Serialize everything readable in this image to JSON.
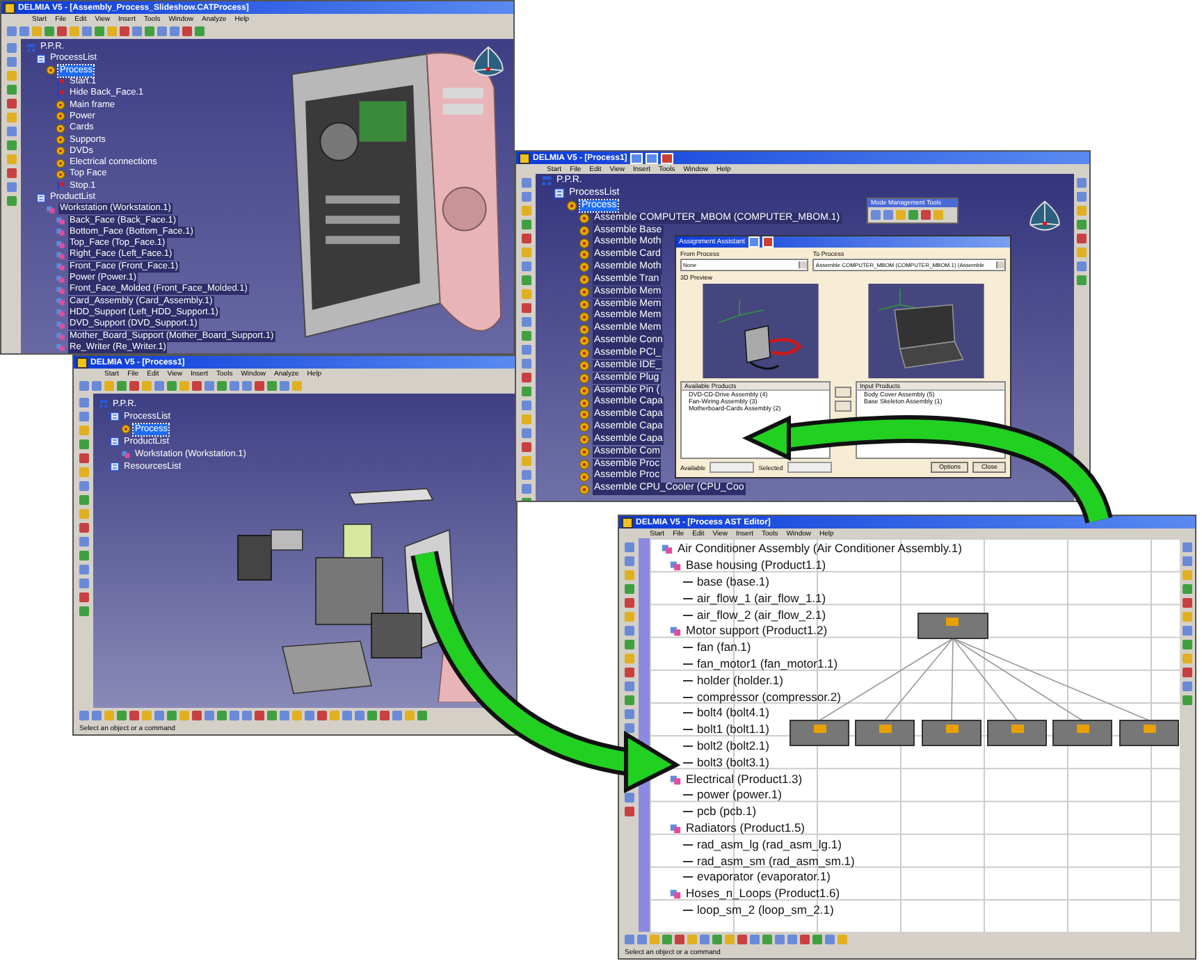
{
  "windows": [
    {
      "title": "DELMIA V5 - [Assembly_Process_Slideshow.CATProcess]",
      "menu": [
        "Start",
        "File",
        "Edit",
        "View",
        "Insert",
        "Tools",
        "Window",
        "Analyze",
        "Help"
      ],
      "tree": [
        {
          "label": "P.P.R.",
          "kind": "root",
          "selected": false,
          "highlighted": false,
          "children": [
            {
              "label": "ProcessList",
              "kind": "list",
              "selected": false,
              "highlighted": false,
              "children": [
                {
                  "label": "Process",
                  "kind": "process",
                  "selected": true,
                  "highlighted": false,
                  "children": [
                    {
                      "label": "Start.1",
                      "kind": "step",
                      "selected": false,
                      "highlighted": false
                    },
                    {
                      "label": "Hide Back_Face.1",
                      "kind": "step",
                      "selected": false,
                      "highlighted": false
                    },
                    {
                      "label": "Main frame",
                      "kind": "process",
                      "selected": false,
                      "highlighted": false
                    },
                    {
                      "label": "Power",
                      "kind": "process",
                      "selected": false,
                      "highlighted": false
                    },
                    {
                      "label": "Cards",
                      "kind": "process",
                      "selected": false,
                      "highlighted": false
                    },
                    {
                      "label": "Supports",
                      "kind": "process",
                      "selected": false,
                      "highlighted": false
                    },
                    {
                      "label": "DVDs",
                      "kind": "process",
                      "selected": false,
                      "highlighted": false
                    },
                    {
                      "label": "Electrical connections",
                      "kind": "process",
                      "selected": false,
                      "highlighted": false
                    },
                    {
                      "label": "Top Face",
                      "kind": "process",
                      "selected": false,
                      "highlighted": false
                    },
                    {
                      "label": "Stop.1",
                      "kind": "step",
                      "selected": false,
                      "highlighted": false
                    }
                  ]
                }
              ]
            },
            {
              "label": "ProductList",
              "kind": "list",
              "selected": false,
              "highlighted": false,
              "children": [
                {
                  "label": "Workstation (Workstation.1)",
                  "kind": "product",
                  "selected": false,
                  "highlighted": true,
                  "children": [
                    {
                      "label": "Back_Face (Back_Face.1)",
                      "kind": "product",
                      "selected": false,
                      "highlighted": true
                    },
                    {
                      "label": "Bottom_Face (Bottom_Face.1)",
                      "kind": "product",
                      "selected": false,
                      "highlighted": true
                    },
                    {
                      "label": "Top_Face (Top_Face.1)",
                      "kind": "product",
                      "selected": false,
                      "highlighted": true
                    },
                    {
                      "label": "Right_Face (Left_Face.1)",
                      "kind": "product",
                      "selected": false,
                      "highlighted": true
                    },
                    {
                      "label": "Front_Face (Front_Face.1)",
                      "kind": "product",
                      "selected": false,
                      "highlighted": true
                    },
                    {
                      "label": "Power (Power.1)",
                      "kind": "product",
                      "selected": false,
                      "highlighted": true
                    },
                    {
                      "label": "Front_Face_Molded (Front_Face_Molded.1)",
                      "kind": "product",
                      "selected": false,
                      "highlighted": true
                    },
                    {
                      "label": "Card_Assembly (Card_Assembly.1)",
                      "kind": "product",
                      "selected": false,
                      "highlighted": true
                    },
                    {
                      "label": "HDD_Support (Left_HDD_Support.1)",
                      "kind": "product",
                      "selected": false,
                      "highlighted": true
                    },
                    {
                      "label": "DVD_Support (DVD_Support.1)",
                      "kind": "product",
                      "selected": false,
                      "highlighted": true
                    },
                    {
                      "label": "Mother_Board_Support (Mother_Board_Support.1)",
                      "kind": "product",
                      "selected": false,
                      "highlighted": true
                    },
                    {
                      "label": "Re_Writer (Re_Writer.1)",
                      "kind": "product",
                      "selected": false,
                      "highlighted": true
                    }
                  ]
                }
              ]
            }
          ]
        }
      ]
    },
    {
      "title": "DELMIA V5 - [Process1]",
      "menu": [
        "Start",
        "File",
        "Edit",
        "View",
        "Insert",
        "Tools",
        "Window",
        "Analyze",
        "Help"
      ],
      "tree": [
        {
          "label": "P.P.R.",
          "kind": "root",
          "selected": false,
          "highlighted": false,
          "children": [
            {
              "label": "ProcessList",
              "kind": "list",
              "selected": false,
              "highlighted": false,
              "children": [
                {
                  "label": "Process",
                  "kind": "process",
                  "selected": true,
                  "highlighted": false
                }
              ]
            },
            {
              "label": "ProductList",
              "kind": "list",
              "selected": false,
              "highlighted": false,
              "children": [
                {
                  "label": "Workstation (Workstation.1)",
                  "kind": "product",
                  "selected": false,
                  "highlighted": false
                }
              ]
            },
            {
              "label": "ResourcesList",
              "kind": "list",
              "selected": false,
              "highlighted": false
            }
          ]
        }
      ],
      "status": "Select an object or a command"
    },
    {
      "title": "DELMIA V5 - [Process1]",
      "menu": [
        "Start",
        "File",
        "Edit",
        "View",
        "Insert",
        "Tools",
        "Window",
        "Help"
      ],
      "tree": [
        {
          "label": "P.P.R.",
          "kind": "root",
          "selected": false,
          "highlighted": false,
          "children": [
            {
              "label": "ProcessList",
              "kind": "list",
              "selected": false,
              "highlighted": false,
              "children": [
                {
                  "label": "Process",
                  "kind": "process",
                  "selected": true,
                  "highlighted": false,
                  "children": [
                    {
                      "label": "Assemble COMPUTER_MBOM (COMPUTER_MBOM.1)",
                      "kind": "process",
                      "selected": false,
                      "highlighted": true
                    },
                    {
                      "label": "Assemble Base",
                      "kind": "process",
                      "selected": false,
                      "highlighted": true
                    },
                    {
                      "label": "Assemble Moth",
                      "kind": "process",
                      "selected": false,
                      "highlighted": true
                    },
                    {
                      "label": "Assemble Card",
                      "kind": "process",
                      "selected": false,
                      "highlighted": true
                    },
                    {
                      "label": "Assemble Moth",
                      "kind": "process",
                      "selected": false,
                      "highlighted": true
                    },
                    {
                      "label": "Assemble Tran",
                      "kind": "process",
                      "selected": false,
                      "highlighted": true
                    },
                    {
                      "label": "Assemble Mem",
                      "kind": "process",
                      "selected": false,
                      "highlighted": true
                    },
                    {
                      "label": "Assemble Mem",
                      "kind": "process",
                      "selected": false,
                      "highlighted": true
                    },
                    {
                      "label": "Assemble Mem",
                      "kind": "process",
                      "selected": false,
                      "highlighted": true
                    },
                    {
                      "label": "Assemble Mem",
                      "kind": "process",
                      "selected": false,
                      "highlighted": true
                    },
                    {
                      "label": "Assemble Conn",
                      "kind": "process",
                      "selected": false,
                      "highlighted": true
                    },
                    {
                      "label": "Assemble PCI_",
                      "kind": "process",
                      "selected": false,
                      "highlighted": true
                    },
                    {
                      "label": "Assemble IDE_",
                      "kind": "process",
                      "selected": false,
                      "highlighted": true
                    },
                    {
                      "label": "Assemble Plug",
                      "kind": "process",
                      "selected": false,
                      "highlighted": true
                    },
                    {
                      "label": "Assemble Pin (",
                      "kind": "process",
                      "selected": false,
                      "highlighted": true
                    },
                    {
                      "label": "Assemble Capa",
                      "kind": "process",
                      "selected": false,
                      "highlighted": true
                    },
                    {
                      "label": "Assemble Capa",
                      "kind": "process",
                      "selected": false,
                      "highlighted": true
                    },
                    {
                      "label": "Assemble Capa",
                      "kind": "process",
                      "selected": false,
                      "highlighted": true
                    },
                    {
                      "label": "Assemble Capa",
                      "kind": "process",
                      "selected": false,
                      "highlighted": true
                    },
                    {
                      "label": "Assemble Com",
                      "kind": "process",
                      "selected": false,
                      "highlighted": true
                    },
                    {
                      "label": "Assemble Proc",
                      "kind": "process",
                      "selected": false,
                      "highlighted": true
                    },
                    {
                      "label": "Assemble Proc",
                      "kind": "process",
                      "selected": false,
                      "highlighted": true
                    },
                    {
                      "label": "Assemble CPU_Cooler (CPU_Coo",
                      "kind": "process",
                      "selected": false,
                      "highlighted": true
                    }
                  ]
                }
              ]
            }
          ]
        }
      ],
      "floating_toolbar": {
        "title": "Mode Management Tools"
      },
      "dialog": {
        "title": "Assignment Assistant",
        "from_label": "From Process",
        "from_value": "None",
        "to_label": "To Process",
        "to_value": "Assemble COMPUTER_MBOM (COMPUTER_MBOM.1) (Assemble",
        "preview_label": "3D Preview",
        "available_header": "Available Products",
        "available_items": [
          "DVD-CD-Drive Assembly (4)",
          "Fan-Wiring Assembly (3)",
          "Motherboard-Cards Assembly (2)"
        ],
        "input_header": "Input Products",
        "input_items": [
          "Body Cover Assembly (5)",
          "Base Skeleton Assembly (1)"
        ],
        "available_label": "Available",
        "selected_label": "Selected",
        "buttons": [
          "Options",
          "Close"
        ]
      }
    },
    {
      "title": "DELMIA V5 - [Process AST Editor]",
      "menu": [
        "Start",
        "File",
        "Edit",
        "View",
        "Insert",
        "Tools",
        "Window",
        "Help"
      ],
      "tree": [
        {
          "label": "Air Conditioner Assembly (Air Conditioner Assembly.1)",
          "kind": "product",
          "selected": false,
          "highlighted": false,
          "children": [
            {
              "label": "Base housing (Product1.1)",
              "kind": "product",
              "selected": false,
              "highlighted": false,
              "children": [
                {
                  "label": "base (base.1)",
                  "kind": "part",
                  "selected": false,
                  "highlighted": false
                },
                {
                  "label": "air_flow_1 (air_flow_1.1)",
                  "kind": "part",
                  "selected": false,
                  "highlighted": false
                },
                {
                  "label": "air_flow_2 (air_flow_2.1)",
                  "kind": "part",
                  "selected": false,
                  "highlighted": false
                }
              ]
            },
            {
              "label": "Motor support (Product1.2)",
              "kind": "product",
              "selected": false,
              "highlighted": false,
              "children": [
                {
                  "label": "fan (fan.1)",
                  "kind": "part",
                  "selected": false,
                  "highlighted": false
                },
                {
                  "label": "fan_motor1 (fan_motor1.1)",
                  "kind": "part",
                  "selected": false,
                  "highlighted": false
                },
                {
                  "label": "holder (holder.1)",
                  "kind": "part",
                  "selected": false,
                  "highlighted": false
                },
                {
                  "label": "compressor (compressor.2)",
                  "kind": "part",
                  "selected": false,
                  "highlighted": false
                },
                {
                  "label": "bolt4 (bolt4.1)",
                  "kind": "part",
                  "selected": false,
                  "highlighted": false
                },
                {
                  "label": "bolt1 (bolt1.1)",
                  "kind": "part",
                  "selected": false,
                  "highlighted": false
                },
                {
                  "label": "bolt2 (bolt2.1)",
                  "kind": "part",
                  "selected": false,
                  "highlighted": false
                },
                {
                  "label": "bolt3 (bolt3.1)",
                  "kind": "part",
                  "selected": false,
                  "highlighted": false
                }
              ]
            },
            {
              "label": "Electrical (Product1.3)",
              "kind": "product",
              "selected": false,
              "highlighted": false,
              "children": [
                {
                  "label": "power (power.1)",
                  "kind": "part",
                  "selected": false,
                  "highlighted": false
                },
                {
                  "label": "pcb (pcb.1)",
                  "kind": "part",
                  "selected": false,
                  "highlighted": false
                }
              ]
            },
            {
              "label": "Radiators (Product1.5)",
              "kind": "product",
              "selected": false,
              "highlighted": false,
              "children": [
                {
                  "label": "rad_asm_lg (rad_asm_lg.1)",
                  "kind": "part",
                  "selected": false,
                  "highlighted": false
                },
                {
                  "label": "rad_asm_sm (rad_asm_sm.1)",
                  "kind": "part",
                  "selected": false,
                  "highlighted": false
                },
                {
                  "label": "evaporator (evaporator.1)",
                  "kind": "part",
                  "selected": false,
                  "highlighted": false
                }
              ]
            },
            {
              "label": "Hoses_n_Loops (Product1.6)",
              "kind": "product",
              "selected": false,
              "highlighted": false,
              "children": [
                {
                  "label": "loop_sm_2 (loop_sm_2.1)",
                  "kind": "part",
                  "selected": false,
                  "highlighted": false
                }
              ]
            }
          ]
        }
      ],
      "status": "Select an object or a command"
    }
  ]
}
